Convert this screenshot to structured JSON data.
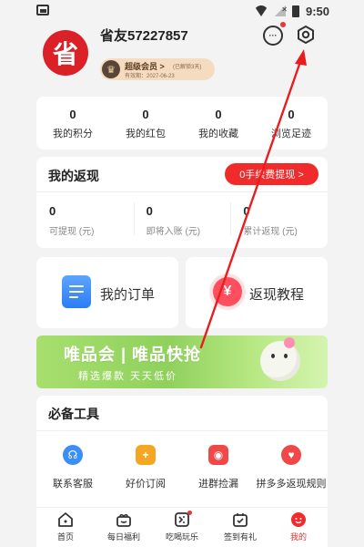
{
  "status_bar": {
    "time": "9:50"
  },
  "profile": {
    "avatar_text": "省",
    "username": "省友57227857",
    "vip": {
      "title": "超级会员 >",
      "note": "(已解锁3天)",
      "expire": "有效期：2027-06-23"
    }
  },
  "header_icons": {
    "message": "message-icon",
    "settings": "gear-icon"
  },
  "stats": [
    {
      "value": "0",
      "label": "我的积分"
    },
    {
      "value": "0",
      "label": "我的红包"
    },
    {
      "value": "0",
      "label": "我的收藏"
    },
    {
      "value": "0",
      "label": "浏览足迹"
    }
  ],
  "cashback": {
    "title": "我的返现",
    "withdraw_button": "0手续费提现 >",
    "items": [
      {
        "value": "0",
        "label": "可提现 (元)"
      },
      {
        "value": "0",
        "label": "即将入账 (元)"
      },
      {
        "value": "0",
        "label": "累计返现 (元)"
      }
    ]
  },
  "cards": {
    "orders": "我的订单",
    "tutorial": "返现教程",
    "yuan_symbol": "¥"
  },
  "banner": {
    "title": "唯品会 | 唯品快抢",
    "subtitle": "精选爆款 天天低价"
  },
  "tools": {
    "title": "必备工具",
    "items": [
      {
        "label": "联系客服",
        "icon": "headset-icon",
        "color": "#3a8ef6"
      },
      {
        "label": "好价订阅",
        "icon": "plus-icon",
        "color": "#f5a623"
      },
      {
        "label": "进群捡漏",
        "icon": "group-icon",
        "color": "#f04848"
      },
      {
        "label": "拼多多返现规则",
        "icon": "heart-icon",
        "color": "#f04848"
      }
    ]
  },
  "tabbar": [
    {
      "label": "首页",
      "icon": "home-icon"
    },
    {
      "label": "每日福利",
      "icon": "gift-icon"
    },
    {
      "label": "吃喝玩乐",
      "icon": "food-icon"
    },
    {
      "label": "签到有礼",
      "icon": "checkin-icon"
    },
    {
      "label": "我的",
      "icon": "mine-icon",
      "active": true
    }
  ],
  "colors": {
    "brand_red": "#f12b2b",
    "avatar_red": "#d92127",
    "banner_green": "#8fd15c"
  }
}
